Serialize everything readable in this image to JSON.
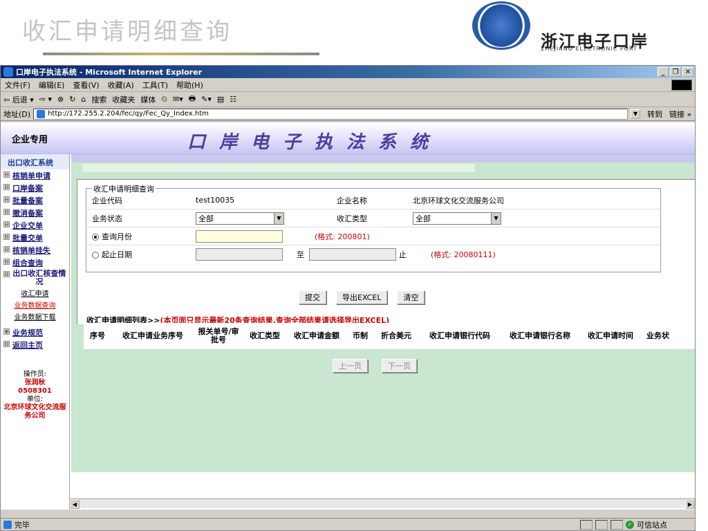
{
  "slide": {
    "title": "收汇申请明细查询",
    "logo_text": "浙江电子口岸",
    "logo_sub": "ZHEJIANG ELECTRONIC PORT"
  },
  "window": {
    "title": "口岸电子执法系统 - Microsoft Internet Explorer",
    "menu": [
      "文件(F)",
      "编辑(E)",
      "查看(V)",
      "收藏(A)",
      "工具(T)",
      "帮助(H)"
    ],
    "toolbar": [
      "⇦ 后退 ▾",
      "⇨ ▾",
      "⊗",
      "↻",
      "⌂",
      "搜索",
      "收藏夹",
      "媒体",
      "⏲",
      "✉▾",
      "🖶",
      "✎▾",
      "▤",
      "☷"
    ],
    "address_label": "地址(D)",
    "address_url": "http://172.255.2.204/fec/qy/Fec_Qy_Index.htm",
    "go_label": "转到",
    "links_label": "链接 »",
    "status_text": "完毕",
    "zone_text": "可信站点"
  },
  "banner": {
    "left": "企业专用",
    "title": "口岸电子执法系统"
  },
  "sidebar": {
    "system_title": "出口收汇系统",
    "items": [
      {
        "box": "⊟",
        "label": "核销单申请"
      },
      {
        "box": "⊟",
        "label": "口岸备案"
      },
      {
        "box": "⊟",
        "label": "批量备案"
      },
      {
        "box": "⊟",
        "label": "撤消备案"
      },
      {
        "box": "⊟",
        "label": "企业交单"
      },
      {
        "box": "⊟",
        "label": "批量交单"
      },
      {
        "box": "⊟",
        "label": "核销单挂失"
      },
      {
        "box": "⊟",
        "label": "组合查询"
      }
    ],
    "group_box": "⊟",
    "group_label": "出口收汇核查情况",
    "sub_items": [
      "收汇申请",
      "业务数据查询",
      "业务数据下载"
    ],
    "extra_items": [
      {
        "box": "⊞",
        "label": "业务规范"
      },
      {
        "box": "⊟",
        "label": "返回主页"
      }
    ],
    "operator_label": "操作员:",
    "operator_name": "张润秋",
    "operator_id": "0508301",
    "unit_label": "单位:",
    "unit_name": "北京环球文化交流服务公司"
  },
  "query": {
    "legend": "收汇申请明细查询",
    "company_code_label": "企业代码",
    "company_code": "test10035",
    "company_name_label": "企业名称",
    "company_name": "北京环球文化交流服务公司",
    "biz_status_label": "业务状态",
    "biz_status_value": "全部",
    "fx_type_label": "收汇类型",
    "fx_type_value": "全部",
    "month_label": "查询月份",
    "month_hint": "(格式: 200801)",
    "range_label": "起止日期",
    "to_label": "至",
    "end_label": "止",
    "range_hint": "(格式: 20080111)"
  },
  "buttons": {
    "submit": "提交",
    "export": "导出EXCEL",
    "clear": "清空"
  },
  "list": {
    "title": "收汇申请明细列表>>",
    "notice": "(本页面只显示最新20条查询结果,查询全部结果请选择导出EXCEL)",
    "columns": [
      "序号",
      "收汇申请业务序号",
      "报关单号/审批号",
      "收汇类型",
      "收汇申请金额",
      "币制",
      "折合美元",
      "收汇申请银行代码",
      "收汇申请银行名称",
      "收汇申请时间",
      "业务状"
    ]
  },
  "pager": {
    "prev": "上一页",
    "next": "下一页"
  },
  "colors": {
    "banner_title": "#4a3ea0",
    "main_bg": "#c8e6d0",
    "hint_red": "#cc0000"
  }
}
